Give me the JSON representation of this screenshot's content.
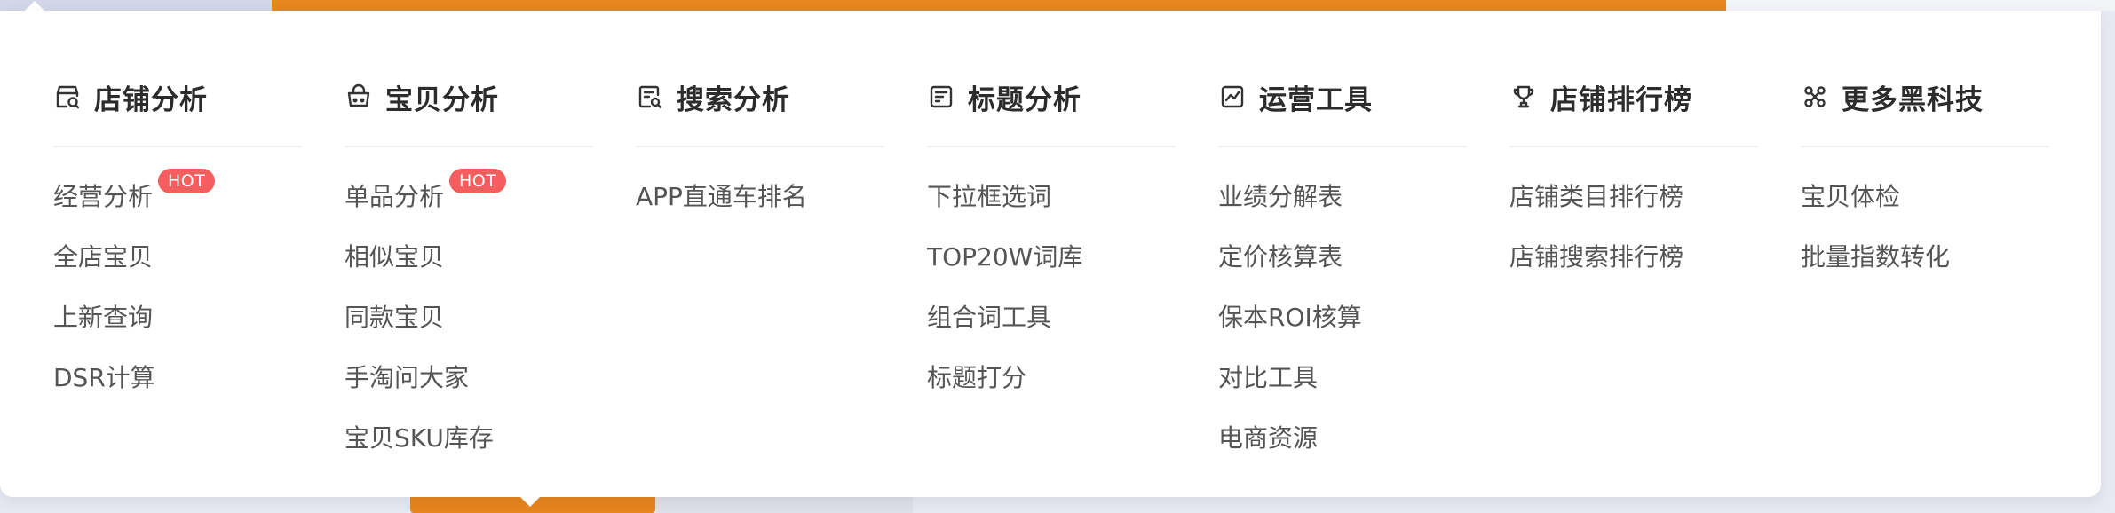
{
  "menu": {
    "columns": [
      {
        "title": "店铺分析",
        "icon": "store-analysis-icon",
        "items": [
          {
            "label": "经营分析",
            "badge": "HOT"
          },
          {
            "label": "全店宝贝"
          },
          {
            "label": "上新查询"
          },
          {
            "label": "DSR计算"
          }
        ]
      },
      {
        "title": "宝贝分析",
        "icon": "shopping-bag-icon",
        "items": [
          {
            "label": "单品分析",
            "badge": "HOT"
          },
          {
            "label": "相似宝贝"
          },
          {
            "label": "同款宝贝"
          },
          {
            "label": "手淘问大家"
          },
          {
            "label": "宝贝SKU库存"
          }
        ]
      },
      {
        "title": "搜索分析",
        "icon": "search-document-icon",
        "items": [
          {
            "label": "APP直通车排名"
          }
        ]
      },
      {
        "title": "标题分析",
        "icon": "title-document-icon",
        "items": [
          {
            "label": "下拉框选词"
          },
          {
            "label": "TOP20W词库"
          },
          {
            "label": "组合词工具"
          },
          {
            "label": "标题打分"
          }
        ]
      },
      {
        "title": "运营工具",
        "icon": "trend-chart-icon",
        "items": [
          {
            "label": "业绩分解表"
          },
          {
            "label": "定价核算表"
          },
          {
            "label": "保本ROI核算"
          },
          {
            "label": "对比工具"
          },
          {
            "label": "电商资源"
          }
        ]
      },
      {
        "title": "店铺排行榜",
        "icon": "trophy-icon",
        "items": [
          {
            "label": "店铺类目排行榜"
          },
          {
            "label": "店铺搜索排行榜"
          }
        ]
      },
      {
        "title": "更多黑科技",
        "icon": "network-nodes-icon",
        "items": [
          {
            "label": "宝贝体检"
          },
          {
            "label": "批量指数转化"
          }
        ]
      }
    ]
  },
  "colors": {
    "accent_orange": "#e8861f",
    "hot_badge": "#f45e5e",
    "title_text": "#2c2c2c",
    "item_text": "#555555"
  }
}
